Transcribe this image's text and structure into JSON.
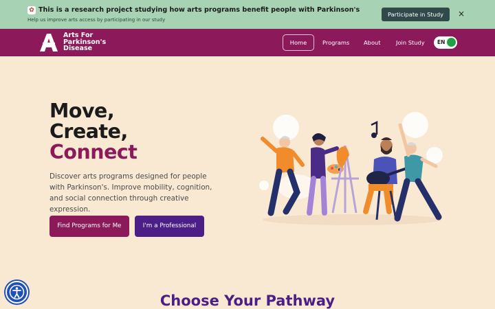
{
  "banner": {
    "icon": "palette-emoji-icon",
    "title": "This is a research project studying how arts programs benefit people with Parkinson's",
    "subtitle": "Help us improve arts access by participating in our study",
    "cta": "Participate in Study",
    "close_symbol": "×"
  },
  "brand": {
    "line1": "Arts For",
    "line2": "Parkinson's",
    "line3": "Disease",
    "color": "#8c1a5a"
  },
  "nav": {
    "items": [
      {
        "label": "Home",
        "active": true
      },
      {
        "label": "Programs"
      },
      {
        "label": "About"
      },
      {
        "label": "Join Study"
      }
    ],
    "lang": "EN"
  },
  "hero": {
    "line1": "Move,",
    "line2": "Create,",
    "line3": "Connect",
    "description": "Discover arts programs designed for people with Parkinson's. Improve mobility, cognition, and social connection through creative expression.",
    "primary_cta": "Find Programs for Me",
    "secondary_cta": "I'm a Professional"
  },
  "pathway": {
    "title": "Choose Your Pathway"
  },
  "colors": {
    "banner_bg": "#a7d3b4",
    "page_bg": "#f9e9d2",
    "plum": "#8c1a5a",
    "purple": "#4b1f86",
    "toggle_on": "#22a046"
  }
}
